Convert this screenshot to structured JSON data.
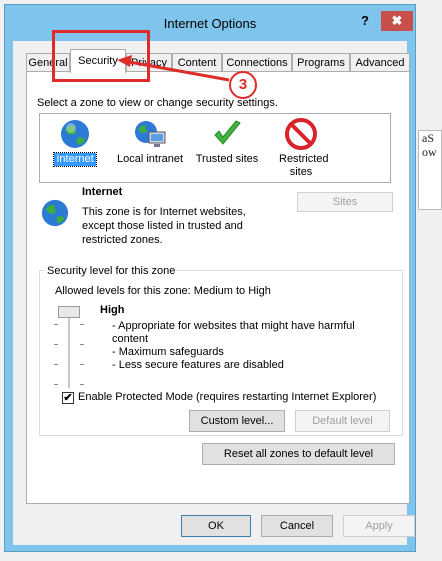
{
  "window": {
    "title": "Internet Options",
    "help_glyph": "?",
    "close_glyph": "✖"
  },
  "background_text": "aS\now",
  "tabs": [
    {
      "label": "General"
    },
    {
      "label": "Security"
    },
    {
      "label": "Privacy"
    },
    {
      "label": "Content"
    },
    {
      "label": "Connections"
    },
    {
      "label": "Programs"
    },
    {
      "label": "Advanced"
    }
  ],
  "annotation": {
    "step": "3",
    "color": "#e02b2b"
  },
  "zones": {
    "prompt": "Select a zone to view or change security settings.",
    "items": [
      {
        "label": "Internet",
        "icon": "globe-icon",
        "selected": true
      },
      {
        "label": "Local intranet",
        "icon": "intranet-icon"
      },
      {
        "label": "Trusted sites",
        "icon": "checkmark-icon"
      },
      {
        "label": "Restricted sites",
        "icon": "restricted-icon"
      }
    ]
  },
  "zone_info": {
    "name": "Internet",
    "description": "This zone is for Internet websites,\nexcept those listed in trusted and\nrestricted zones.",
    "sites_button": "Sites"
  },
  "security_level": {
    "group_title": "Security level for this zone",
    "allowed": "Allowed levels for this zone: Medium to High",
    "level": "High",
    "bullets": [
      "- Appropriate for websites that might have harmful",
      "content",
      "- Maximum safeguards",
      "- Less secure features are disabled"
    ],
    "slider_level_fraction": 1.0
  },
  "protected_mode": {
    "label": "Enable Protected Mode (requires restarting Internet Explorer)",
    "checked": true,
    "check_glyph": "✔"
  },
  "buttons": {
    "custom_level": "Custom level...",
    "default_level": "Default level",
    "reset_all": "Reset all zones to default level",
    "ok": "OK",
    "cancel": "Cancel",
    "apply": "Apply"
  }
}
